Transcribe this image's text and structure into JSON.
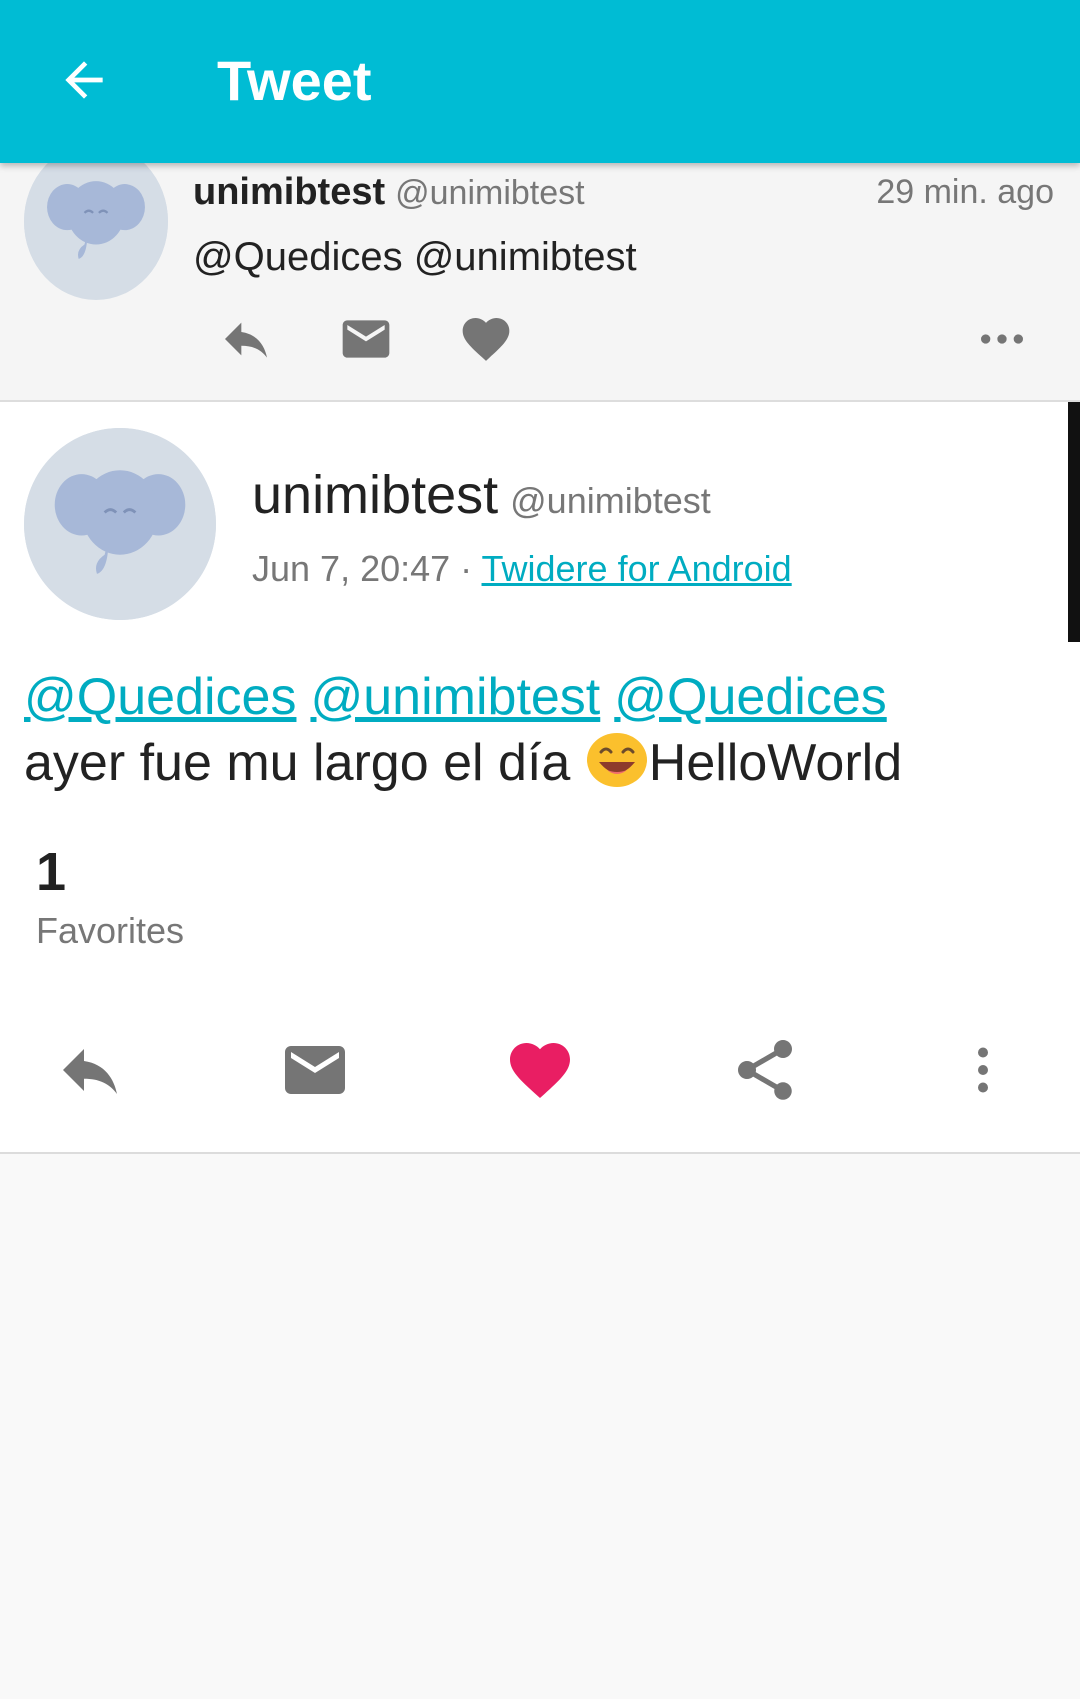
{
  "toolbar": {
    "title": "Tweet",
    "back_icon": "arrow-left-icon"
  },
  "parent_tweet": {
    "name": "unimibtest",
    "handle": "@unimibtest",
    "time": "29 min. ago",
    "text": "@Quedices @unimibtest",
    "actions": [
      "reply-icon",
      "message-icon",
      "heart-icon",
      "more-horizontal-icon"
    ]
  },
  "status": {
    "name": "unimibtest",
    "handle": "@unimibtest",
    "date": "Jun 7, 20:47",
    "separator": " · ",
    "source": "Twidere for Android",
    "mentions": [
      "@Quedices",
      "@unimibtest",
      "@Quedices"
    ],
    "text_before_emoji": "ayer fue mu largo el día ",
    "text_after_emoji": "HelloWorld",
    "favorites_count": "1",
    "favorites_label": "Favorites",
    "actions": [
      "reply-icon",
      "message-icon",
      "heart-icon",
      "share-icon",
      "more-vertical-icon"
    ],
    "favorite_color": "#e91e63"
  },
  "colors": {
    "accent": "#00bcd4",
    "link": "#00acc1",
    "icon_gray": "#757575"
  }
}
